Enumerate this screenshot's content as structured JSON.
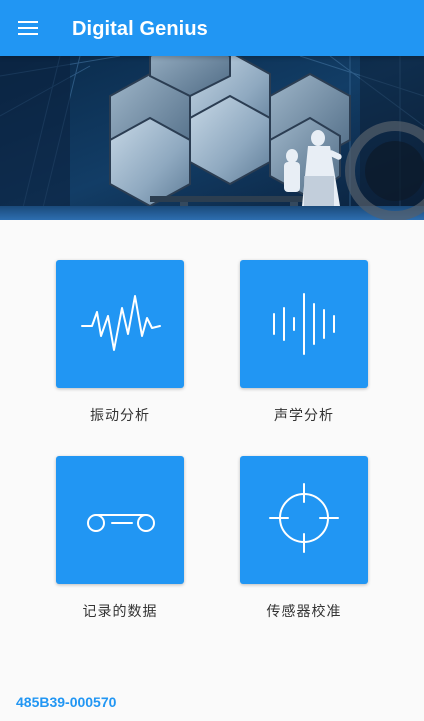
{
  "appbar": {
    "title": "Digital Genius",
    "menu_icon": "hamburger-menu-icon",
    "color": "#2196f3"
  },
  "hero": {
    "image": "telescope-mirror-segments-banner"
  },
  "tiles": [
    {
      "label": "振动分析",
      "icon": "vibration-wave-icon"
    },
    {
      "label": "声学分析",
      "icon": "sound-bars-icon"
    },
    {
      "label": "记录的数据",
      "icon": "recorded-tape-icon"
    },
    {
      "label": "传感器校准",
      "icon": "crosshair-target-icon"
    }
  ],
  "footer": {
    "device_id": "485B39-000570"
  }
}
